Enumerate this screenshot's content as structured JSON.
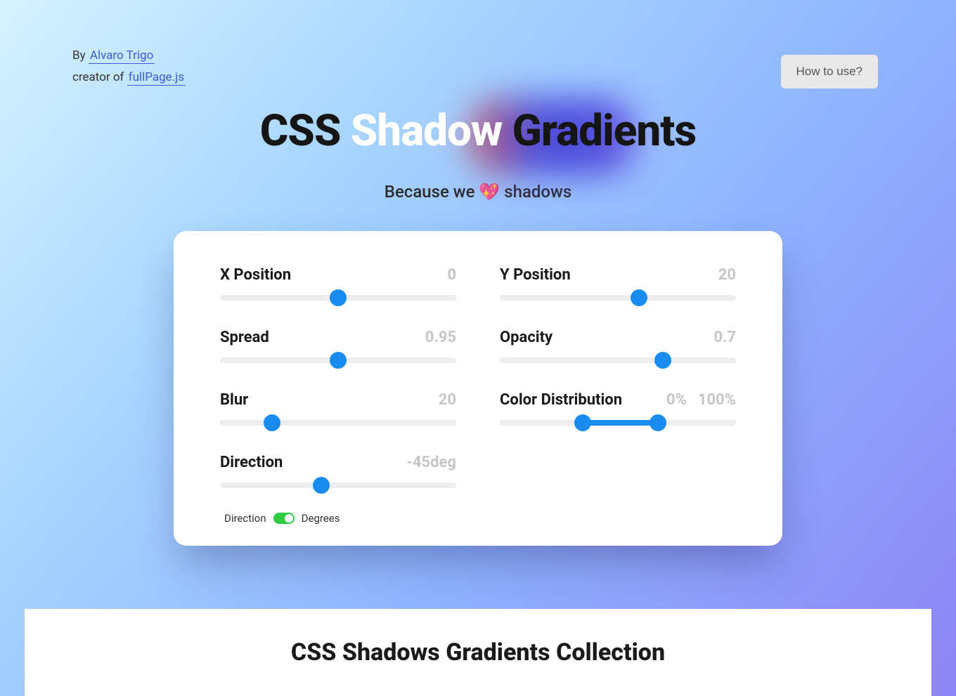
{
  "credits": {
    "by_prefix": "By",
    "author": "Alvaro Trigo",
    "creator_prefix": "creator of",
    "project": "fullPage.js"
  },
  "how_to_use": "How to use?",
  "title": {
    "pre": "CSS ",
    "shadow": "Shadow",
    "post": " Gradients"
  },
  "subtitle": "Because we 💖 shadows",
  "sliders": {
    "x_position": {
      "label": "X Position",
      "value": "0",
      "thumb_pct": 50
    },
    "y_position": {
      "label": "Y Position",
      "value": "20",
      "thumb_pct": 59
    },
    "spread": {
      "label": "Spread",
      "value": "0.95",
      "thumb_pct": 50
    },
    "opacity": {
      "label": "Opacity",
      "value": "0.7",
      "thumb_pct": 69
    },
    "blur": {
      "label": "Blur",
      "value": "20",
      "thumb_pct": 22
    },
    "color_dist": {
      "label": "Color Distribution",
      "value_low": "0%",
      "value_high": "100%",
      "thumb_low_pct": 35,
      "thumb_high_pct": 67
    },
    "direction": {
      "label": "Direction",
      "value": "-45deg",
      "thumb_pct": 43
    }
  },
  "toggle": {
    "left_label": "Direction",
    "right_label": "Degrees",
    "state": "on"
  },
  "collection_title": "CSS Shadows Gradients Collection"
}
